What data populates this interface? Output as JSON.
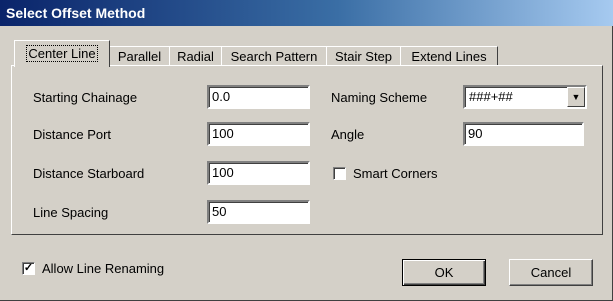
{
  "window": {
    "title": "Select Offset Method"
  },
  "tabs": [
    {
      "label": "Center Line"
    },
    {
      "label": "Parallel"
    },
    {
      "label": "Radial"
    },
    {
      "label": "Search Pattern"
    },
    {
      "label": "Stair Step"
    },
    {
      "label": "Extend Lines"
    }
  ],
  "active_tab": "Center Line",
  "form": {
    "starting_chainage": {
      "label": "Starting Chainage",
      "value": "0.0"
    },
    "distance_port": {
      "label": "Distance Port",
      "value": "100"
    },
    "distance_starboard": {
      "label": "Distance Starboard",
      "value": "100"
    },
    "line_spacing": {
      "label": "Line Spacing",
      "value": "50"
    },
    "naming_scheme": {
      "label": "Naming Scheme",
      "value": "###+##"
    },
    "angle": {
      "label": "Angle",
      "value": "90"
    },
    "smart_corners": {
      "label": "Smart Corners",
      "checked": false
    }
  },
  "allow_line_renaming": {
    "label": "Allow Line Renaming",
    "checked": true,
    "mark": "✓"
  },
  "buttons": {
    "ok": "OK",
    "cancel": "Cancel"
  }
}
